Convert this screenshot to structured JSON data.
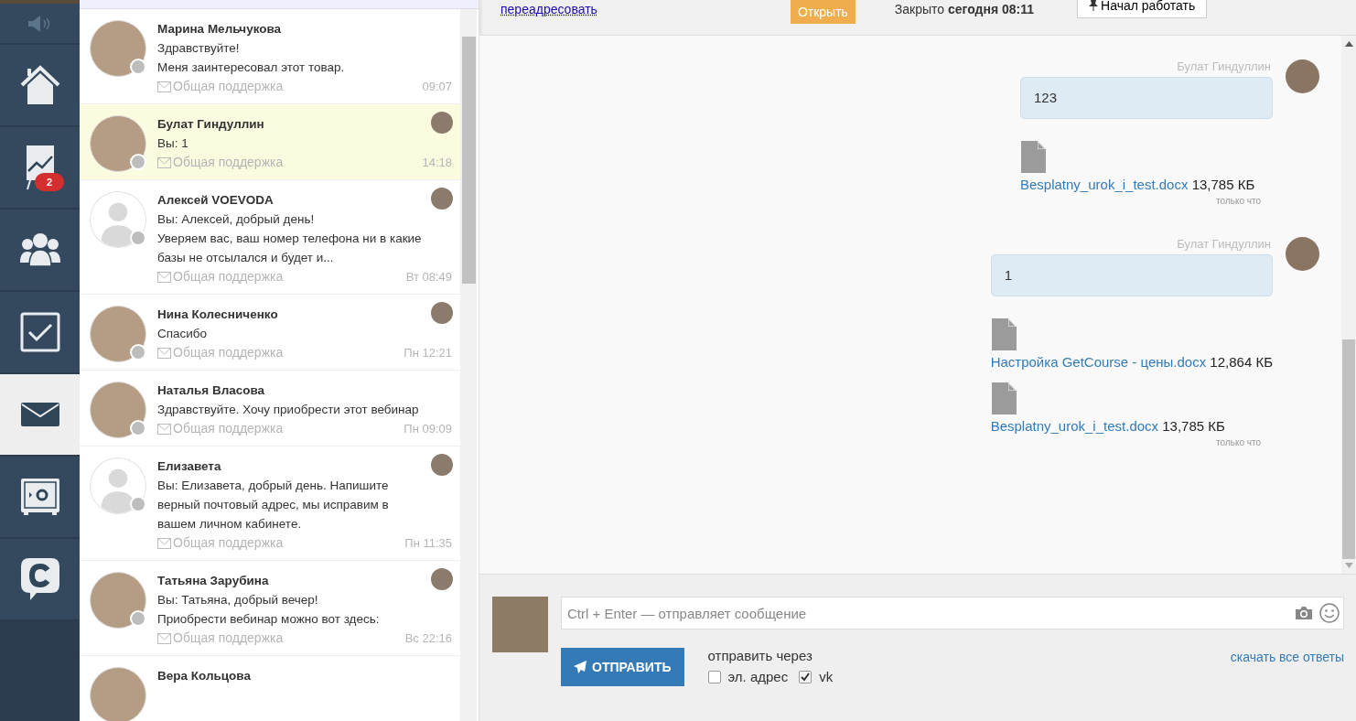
{
  "sidebar": {
    "items": [
      {
        "kind": "speaker",
        "selected": false
      },
      {
        "kind": "home",
        "selected": false
      },
      {
        "kind": "chart",
        "selected": false,
        "badge": "2"
      },
      {
        "kind": "people",
        "selected": false
      },
      {
        "kind": "check",
        "selected": false
      },
      {
        "kind": "mail",
        "selected": true
      },
      {
        "kind": "safe",
        "selected": false
      },
      {
        "kind": "chat",
        "selected": false
      }
    ]
  },
  "conversations": [
    {
      "name": "Марина Мельчукова",
      "lines": [
        "Здравствуйте!",
        "Меня заинтересовал этот товар."
      ],
      "channel": "Общая поддержка",
      "time": "09:07",
      "avatar": {
        "kind": "photo"
      },
      "agent_avatar": false,
      "selected": false
    },
    {
      "name": "Булат Гиндуллин",
      "lines": [
        "Вы: 1"
      ],
      "channel": "Общая поддержка",
      "time": "14:18",
      "avatar": {
        "kind": "photo"
      },
      "agent_avatar": true,
      "selected": true
    },
    {
      "name": "Алексей VOEVODA",
      "lines": [
        "Вы: Алексей, добрый день!",
        "Уверяем вас, ваш номер телефона ни в какие базы не отсылался и будет и..."
      ],
      "channel": "Общая поддержка",
      "time": "Вт 08:49",
      "avatar": {
        "kind": "silhouette"
      },
      "agent_avatar": true,
      "selected": false
    },
    {
      "name": "Нина Колесниченко",
      "lines": [
        "Спасибо"
      ],
      "channel": "Общая поддержка",
      "time": "Пн 12:21",
      "avatar": {
        "kind": "photo"
      },
      "agent_avatar": true,
      "selected": false
    },
    {
      "name": "Наталья Власова",
      "lines": [
        "Здравствуйте. Хочу приобрести этот вебинар"
      ],
      "channel": "Общая поддержка",
      "time": "Пн 09:09",
      "avatar": {
        "kind": "photo"
      },
      "agent_avatar": false,
      "selected": false
    },
    {
      "name": "Елизавета",
      "lines": [
        "Вы: Елизавета, добрый день. Напишите верный почтовый адрес, мы исправим в вашем личном кабинете."
      ],
      "channel": "Общая поддержка",
      "time": "Пн 11:35",
      "avatar": {
        "kind": "silhouette"
      },
      "agent_avatar": true,
      "selected": false
    },
    {
      "name": "Татьяна Зарубина",
      "lines": [
        "Вы: Татьяна, добрый вечер!",
        "Приобрести вебинар можно вот здесь:"
      ],
      "channel": "Общая поддержка",
      "time": "Вс 22:16",
      "avatar": {
        "kind": "photo"
      },
      "agent_avatar": true,
      "selected": false
    },
    {
      "name": "Вера Кольцова",
      "avatar": {
        "kind": "photo"
      },
      "agent_avatar": false,
      "selected": false
    }
  ],
  "header": {
    "forward_link": "переадресовать",
    "open_button": "Открыть",
    "closed_status": "Закрыто **сегодня 08:11**",
    "start_button": "Начал работать"
  },
  "messages": [
    {
      "author": "Булат Гиндуллин",
      "text": "123",
      "attachments": [
        {
          "file": "Besplatny_urok_i_test.docx",
          "size": "13,785 КБ"
        }
      ],
      "time": "только что"
    },
    {
      "author": "Булат Гиндуллин",
      "text": "1",
      "attachments": [
        {
          "file": "Настройка GetCourse - цены.docx",
          "size": "12,864 КБ"
        },
        {
          "file": "Besplatny_urok_i_test.docx",
          "size": "13,785 КБ"
        }
      ],
      "time": "только что"
    }
  ],
  "composer": {
    "placeholder": "Ctrl + Enter — отправляет сообщение",
    "send_button": "ОТПРАВИТЬ",
    "send_via_label": "отправить через",
    "channels": [
      {
        "label": "эл. адрес",
        "checked": false
      },
      {
        "label": "vk",
        "checked": true
      }
    ],
    "download_link": "скачать все ответы"
  }
}
